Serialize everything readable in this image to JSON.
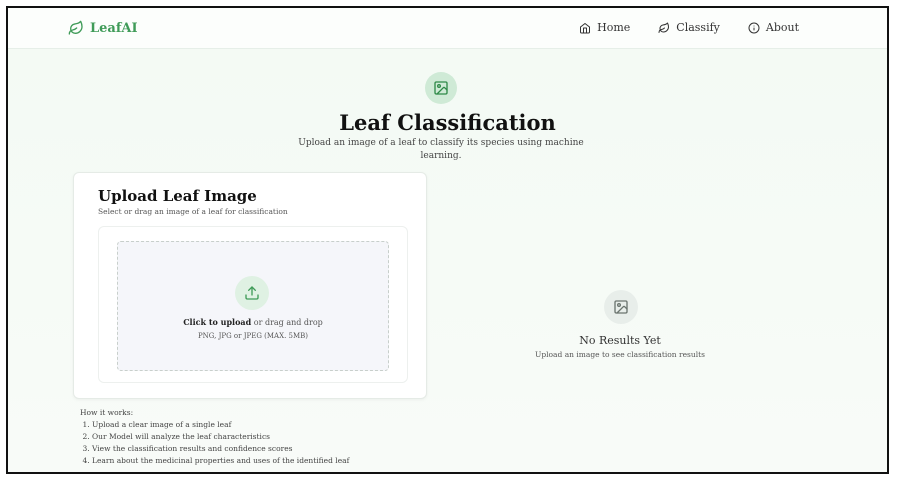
{
  "navbar": {
    "brand": "LeafAI",
    "items": [
      {
        "label": "Home",
        "icon": "home-icon"
      },
      {
        "label": "Classify",
        "icon": "leaf-icon"
      },
      {
        "label": "About",
        "icon": "info-icon"
      }
    ]
  },
  "hero": {
    "icon": "image-icon",
    "title": "Leaf Classification",
    "subtitle": "Upload an image of a leaf to classify its species using machine learning."
  },
  "upload": {
    "title": "Upload Leaf Image",
    "description": "Select or drag an image of a leaf for classification",
    "click_label": "Click to upload",
    "drag_label": " or drag and drop",
    "formats": "PNG, JPG or JPEG (MAX. 5MB)",
    "icon": "upload-icon"
  },
  "results": {
    "icon": "image-icon",
    "title": "No Results Yet",
    "subtitle": "Upload an image to see classification results"
  },
  "how_it_works": {
    "heading": "How it works:",
    "steps": [
      "Upload a clear image of a single leaf",
      "Our Model will analyze the leaf characteristics",
      "View the classification results and confidence scores",
      "Learn about the medicinal properties and uses of the identified leaf"
    ]
  },
  "colors": {
    "accent": "#3f9b58",
    "background": "#f3faf4"
  }
}
